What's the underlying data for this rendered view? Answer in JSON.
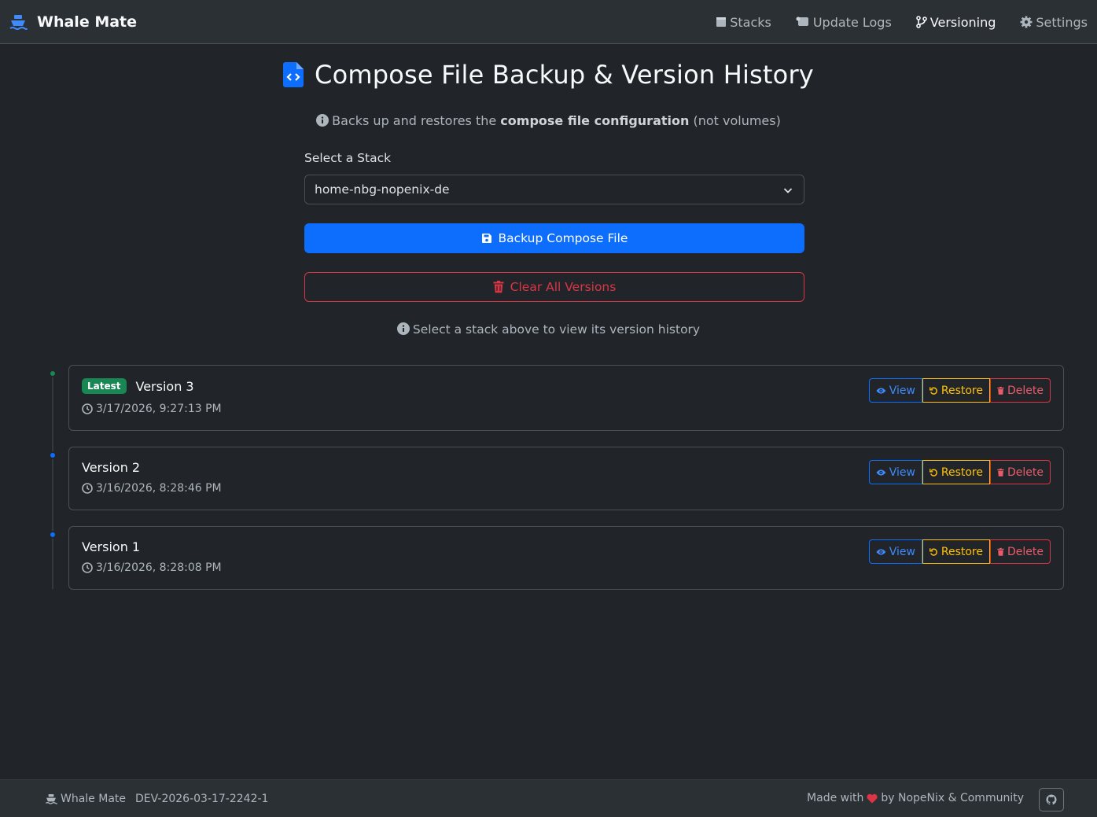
{
  "app": {
    "brand": "Whale Mate"
  },
  "nav": {
    "items": [
      {
        "label": "Stacks",
        "icon": "box-icon"
      },
      {
        "label": "Update Logs",
        "icon": "scroll-icon"
      },
      {
        "label": "Versioning",
        "icon": "branch-icon",
        "active": true
      },
      {
        "label": "Settings",
        "icon": "gear-icon"
      }
    ]
  },
  "page": {
    "title": "Compose File Backup & Version History",
    "subtitle_pre": "Backs up and restores the ",
    "subtitle_bold": "compose file configuration",
    "subtitle_post": " (not volumes)",
    "select_label": "Select a Stack",
    "selected_stack": "home-nbg-nopenix-de",
    "backup_label": "Backup Compose File",
    "clear_label": "Clear All Versions",
    "hint": "Select a stack above to view its version history"
  },
  "versions": [
    {
      "badge": "Latest",
      "title": "Version 3",
      "date": "3/17/2026, 9:27:13 PM"
    },
    {
      "badge": "",
      "title": "Version 2",
      "date": "3/16/2026, 8:28:46 PM"
    },
    {
      "badge": "",
      "title": "Version 1",
      "date": "3/16/2026, 8:28:08 PM"
    }
  ],
  "version_actions": {
    "view": "View",
    "restore": "Restore",
    "delete": "Delete"
  },
  "footer": {
    "brand": "Whale Mate",
    "build": "DEV-2026-03-17-2242-1",
    "made_with": "Made with",
    "by": "by NopeNix & Community"
  },
  "colors": {
    "primary": "#0d6efd",
    "danger": "#dc3545",
    "warning": "#ffc107",
    "success": "#198754",
    "background": "#212529"
  }
}
